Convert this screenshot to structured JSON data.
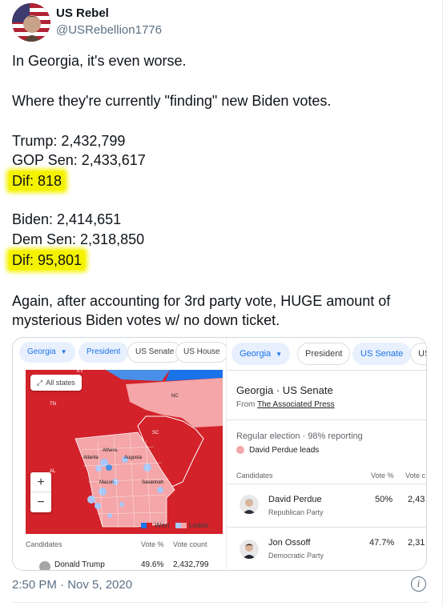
{
  "author": {
    "display_name": "US Rebel",
    "handle": "@USRebellion1776"
  },
  "tweet": {
    "line1": "In Georgia, it's even worse.",
    "line2": "Where they're currently \"finding\" new Biden votes.",
    "trump": "Trump: 2,432,799",
    "gop_sen": "GOP Sen: 2,433,617",
    "dif1": "Dif: 818",
    "biden": "Biden: 2,414,651",
    "dem_sen": "Dem Sen: 2,318,850",
    "dif2": "Dif: 95,801",
    "line3": "Again, after accounting for 3rd party vote, HUGE amount of",
    "line4": "mysterious Biden votes w/ no down ticket.",
    "timestamp": "2:50 PM · Nov 5, 2020"
  },
  "left_panel": {
    "chips": [
      "Georgia",
      "President",
      "US Senate",
      "US House"
    ],
    "all_states": "All states",
    "map_labels": {
      "ky": "KY",
      "tn": "TN",
      "nc": "NC",
      "sc": "SC",
      "al": "AL",
      "athens": "Athens",
      "atlanta": "Atlanta",
      "augusta": "Augusta",
      "macon": "Macon",
      "savannah": "Savannah"
    },
    "zoom_in": "+",
    "zoom_out": "−",
    "legend_won": "Won",
    "legend_leads": "Leads",
    "columns": [
      "Candidates",
      "Vote %",
      "Vote count"
    ],
    "row": {
      "name": "Donald Trump",
      "pct": "49.6%",
      "count": "2,432,799"
    }
  },
  "right_panel": {
    "chips": [
      "Georgia",
      "President",
      "US Senate",
      "US"
    ],
    "title": "Georgia · US Senate",
    "source_prefix": "From",
    "source": "The Associated Press",
    "election": "Regular election · 98% reporting",
    "leads": "David Perdue leads",
    "columns": [
      "Candidates",
      "Vote %",
      "Vote c"
    ],
    "candidates": [
      {
        "name": "David Perdue",
        "party": "Republican Party",
        "pct": "50%",
        "count": "2,43"
      },
      {
        "name": "Jon Ossoff",
        "party": "Democratic Party",
        "pct": "47.7%",
        "count": "2,31"
      }
    ]
  },
  "colors": {
    "highlight": "#f5f200",
    "rep_won": "#d3222a",
    "rep_leads": "#f4a6a8",
    "dem_won": "#1a73e8",
    "dem_leads": "#a8c7fa",
    "chip_active_bg": "#e8f0fe"
  },
  "icons": {
    "avatar": "flag-avatar",
    "expand": "expand-icon",
    "info": "info-icon",
    "caret": "caret-down-icon"
  }
}
